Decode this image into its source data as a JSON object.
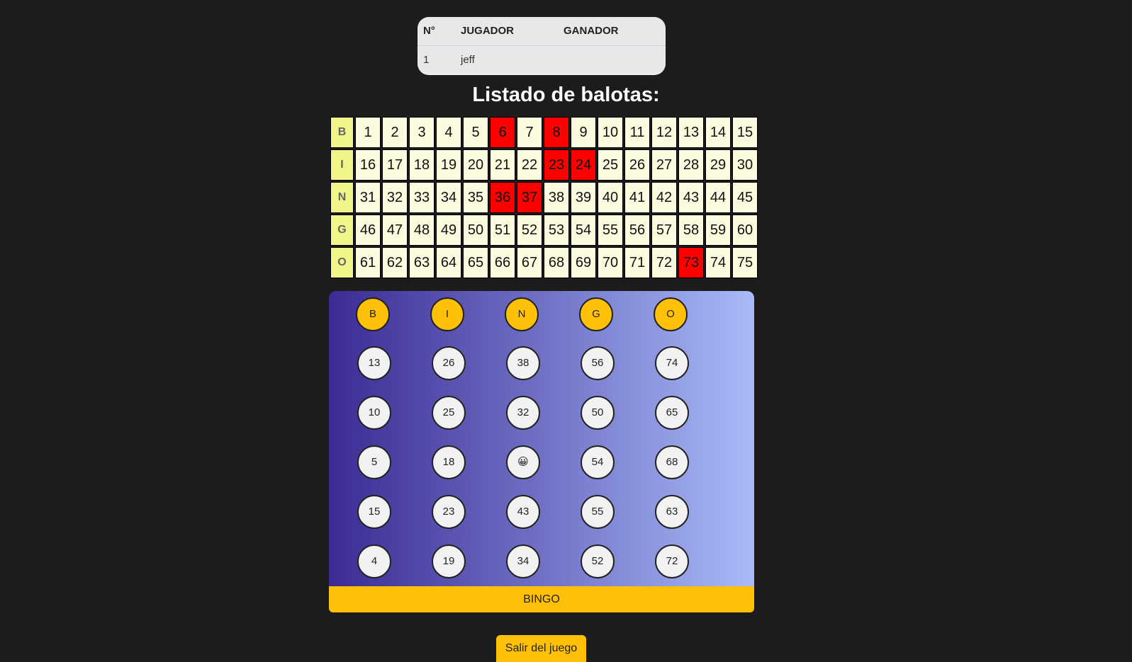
{
  "players_table": {
    "headers": [
      "N°",
      "JUGADOR",
      "GANADOR"
    ],
    "rows": [
      [
        "1",
        "jeff",
        ""
      ]
    ]
  },
  "title": "Listado de balotas:",
  "balotas": {
    "rows": [
      {
        "letter": "B",
        "numbers": [
          1,
          2,
          3,
          4,
          5,
          6,
          7,
          8,
          9,
          10,
          11,
          12,
          13,
          14,
          15
        ]
      },
      {
        "letter": "I",
        "numbers": [
          16,
          17,
          18,
          19,
          20,
          21,
          22,
          23,
          24,
          25,
          26,
          27,
          28,
          29,
          30
        ]
      },
      {
        "letter": "N",
        "numbers": [
          31,
          32,
          33,
          34,
          35,
          36,
          37,
          38,
          39,
          40,
          41,
          42,
          43,
          44,
          45
        ]
      },
      {
        "letter": "G",
        "numbers": [
          46,
          47,
          48,
          49,
          50,
          51,
          52,
          53,
          54,
          55,
          56,
          57,
          58,
          59,
          60
        ]
      },
      {
        "letter": "O",
        "numbers": [
          61,
          62,
          63,
          64,
          65,
          66,
          67,
          68,
          69,
          70,
          71,
          72,
          73,
          74,
          75
        ]
      }
    ],
    "drawn": [
      6,
      8,
      23,
      24,
      36,
      37,
      73
    ],
    "drawn_color": "#ff0000",
    "cell_color": "#fbfbe0",
    "letter_color": "#f1f58a"
  },
  "card": {
    "headers": [
      "B",
      "I",
      "N",
      "G",
      "O"
    ],
    "rows": [
      [
        "13",
        "26",
        "38",
        "56",
        "74"
      ],
      [
        "10",
        "25",
        "32",
        "50",
        "65"
      ],
      [
        "5",
        "18",
        "😀",
        "54",
        "68"
      ],
      [
        "15",
        "23",
        "43",
        "55",
        "63"
      ],
      [
        "4",
        "19",
        "34",
        "52",
        "72"
      ]
    ],
    "header_color": "#ffc107"
  },
  "bingo_button": "BINGO",
  "exit_button": "Salir del juego"
}
